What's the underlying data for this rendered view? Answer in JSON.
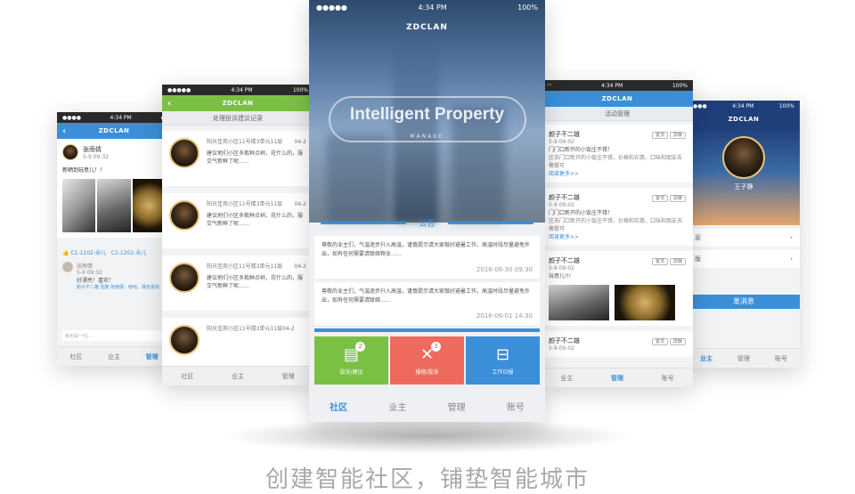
{
  "brand": "ZDCLAN",
  "status": {
    "time": "4:34 PM",
    "battery": "100%"
  },
  "phone1": {
    "user": "张雨倩",
    "date": "5-9 09:32",
    "post_text": "新晒到玩意儿！！",
    "likes": [
      "C1-1202-朵儿",
      "C1-1202-朵儿"
    ],
    "commenter": "张雨倩",
    "comment_date": "5-9 09:32",
    "comment_text": "好漂亮！喜欢！",
    "reply": "颜子不二雄 回复 张雨倩：哈哈，我也喜欢",
    "input_placeholder": "我也说一句...",
    "tabs": [
      "社区",
      "业主",
      "管理"
    ]
  },
  "phone2": {
    "title": "处理投诉建议记录",
    "items": [
      {
        "addr": "阳光佳苑小区11号楼3单元11层",
        "date": "04-2",
        "text": "建议地们小区多栽种点树，花什么的，服交气新鲜了呢......"
      },
      {
        "addr": "阳光佳苑小区11号楼3单元11层",
        "date": "04-2",
        "text": "建议地们小区多栽种点树，花什么的，服交气新鲜了呢......"
      },
      {
        "addr": "阳光佳苑小区11号楼3单元11层",
        "date": "04-2",
        "text": "建议地们小区多栽种点树，花什么的，服交气新鲜了呢......"
      },
      {
        "addr": "阳光佳苑小区11号楼3单元11层",
        "date": "04-2",
        "text": ""
      }
    ],
    "tabs": [
      "社区",
      "业主",
      "管理"
    ]
  },
  "phone3": {
    "status_time": "4:34 PM",
    "status_battery": "100%",
    "brand": "ZDCLAN",
    "hero_title": "Intelligent Property",
    "hero_subtitle": "MANAGE",
    "notice_label": "公告",
    "notices": [
      {
        "text": "尊敬的业主们，气温逐步升入高温，谨慎提示请大家做好避暑工作。高温时段尽量避免外出，如有任何需要请联络物业......",
        "date": "2016-06-30 09:30"
      },
      {
        "text": "尊敬的业主们，气温逐步升入高温，谨慎提示请大家做好避暑工作。高温时段尽量避免外出，如有任何需要请联络......",
        "date": "2016-06-01 14:30"
      }
    ],
    "tiles": [
      {
        "label": "投诉/建议",
        "badge": "2",
        "icon": "document-icon"
      },
      {
        "label": "报修/投诉",
        "badge": "3",
        "icon": "tools-icon"
      },
      {
        "label": "工作日报",
        "badge": "",
        "icon": "toolbox-icon"
      }
    ],
    "tabs": [
      "社区",
      "业主",
      "管理",
      "账号"
    ]
  },
  "phone4": {
    "title": "活动管理",
    "items": [
      {
        "name": "颜子不二雄",
        "date": "5-9 09:02",
        "text": "门门口新开的小饭庄不错！",
        "sub": "区去门口新开的小饭庄不错，价格和实惠，口味和朋友去聚餐可",
        "more": "阅读更多>>"
      },
      {
        "name": "颜子不二雄",
        "date": "5-9 09:02",
        "text": "门门口新开的小饭庄不错！",
        "sub": "区去门口新开的小饭庄不错，价格和实惠，口味和朋友去聚餐可",
        "more": "阅读更多>>"
      },
      {
        "name": "颜子不二雄",
        "date": "5-9 09:02",
        "text": "玩意儿!!!",
        "sub": "",
        "more": ""
      },
      {
        "name": "颜子不二雄",
        "date": "5-9 09:02",
        "text": "",
        "sub": "",
        "more": ""
      }
    ],
    "btn_top": "置顶",
    "btn_block": "屏蔽",
    "tabs": [
      "业主",
      "管理",
      "账号"
    ]
  },
  "phone5": {
    "username": "王子静",
    "rows": [
      "息",
      "版"
    ],
    "send_button": "发消息",
    "tabs": [
      "业主",
      "管理",
      "账号"
    ]
  },
  "tagline": "创建智能社区，铺垫智能城市"
}
